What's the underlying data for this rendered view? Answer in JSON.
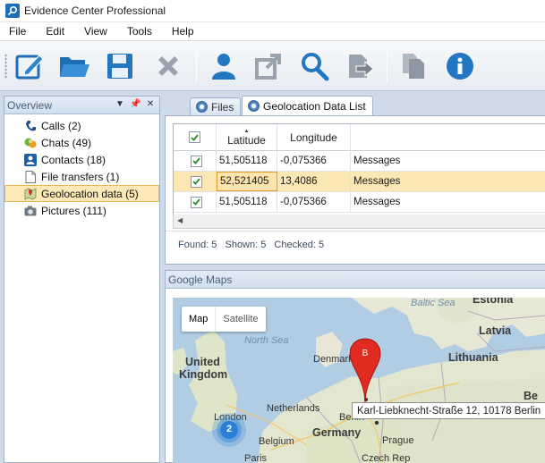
{
  "window": {
    "title": "Evidence Center Professional"
  },
  "menu": [
    "File",
    "Edit",
    "View",
    "Tools",
    "Help"
  ],
  "toolbar": {
    "buttons": [
      "edit-icon",
      "open-folder-icon",
      "save-icon",
      "delete-icon",
      "user-icon",
      "export-icon",
      "search-icon",
      "import-icon",
      "copy-icon",
      "info-icon"
    ]
  },
  "overview": {
    "title": "Overview",
    "items": [
      {
        "label": "Calls (2)",
        "icon": "phone-icon"
      },
      {
        "label": "Chats (49)",
        "icon": "chat-icon"
      },
      {
        "label": "Contacts (18)",
        "icon": "contact-icon"
      },
      {
        "label": "File transfers (1)",
        "icon": "file-icon"
      },
      {
        "label": "Geolocation data (5)",
        "icon": "geolocation-icon"
      },
      {
        "label": "Pictures (111)",
        "icon": "camera-icon"
      }
    ]
  },
  "tabs": [
    {
      "label": "Files"
    },
    {
      "label": "Geolocation Data List"
    }
  ],
  "grid": {
    "columns": [
      "",
      "Latitude",
      "Longitude",
      ""
    ],
    "rows": [
      {
        "checked": true,
        "latitude": "51,505118",
        "longitude": "-0,075366",
        "source": "Messages"
      },
      {
        "checked": true,
        "latitude": "52,521405",
        "longitude": "13,4086",
        "source": "Messages"
      },
      {
        "checked": true,
        "latitude": "51,505118",
        "longitude": "-0,075366",
        "source": "Messages"
      }
    ],
    "status": {
      "found": "Found: 5",
      "shown": "Shown: 5",
      "checked": "Checked: 5"
    }
  },
  "maps": {
    "title": "Google Maps",
    "toggle": {
      "map": "Map",
      "satellite": "Satellite"
    },
    "labels": {
      "estonia": "Estonia",
      "latvia": "Latvia",
      "lithuania": "Lithuania",
      "baltic_sea": "Baltic Sea",
      "north_sea": "North Sea",
      "denmark": "Denmark",
      "united": "United",
      "kingdom": "Kingdom",
      "netherlands": "Netherlands",
      "london": "London",
      "berlin": "Berlin",
      "germany": "Germany",
      "belgium": "Belgium",
      "prague": "Prague",
      "czech_rep": "Czech Rep",
      "paris": "Paris",
      "be": "Be"
    },
    "marker_label": "B",
    "cluster_count": "2",
    "tooltip": "Karl-Liebknecht-Straße 12, 10178 Berlin",
    "colors": {
      "water": "#b1cde4",
      "land": "#ece8df",
      "marker": "#e02b20",
      "cluster": "#2c7fd6"
    }
  }
}
